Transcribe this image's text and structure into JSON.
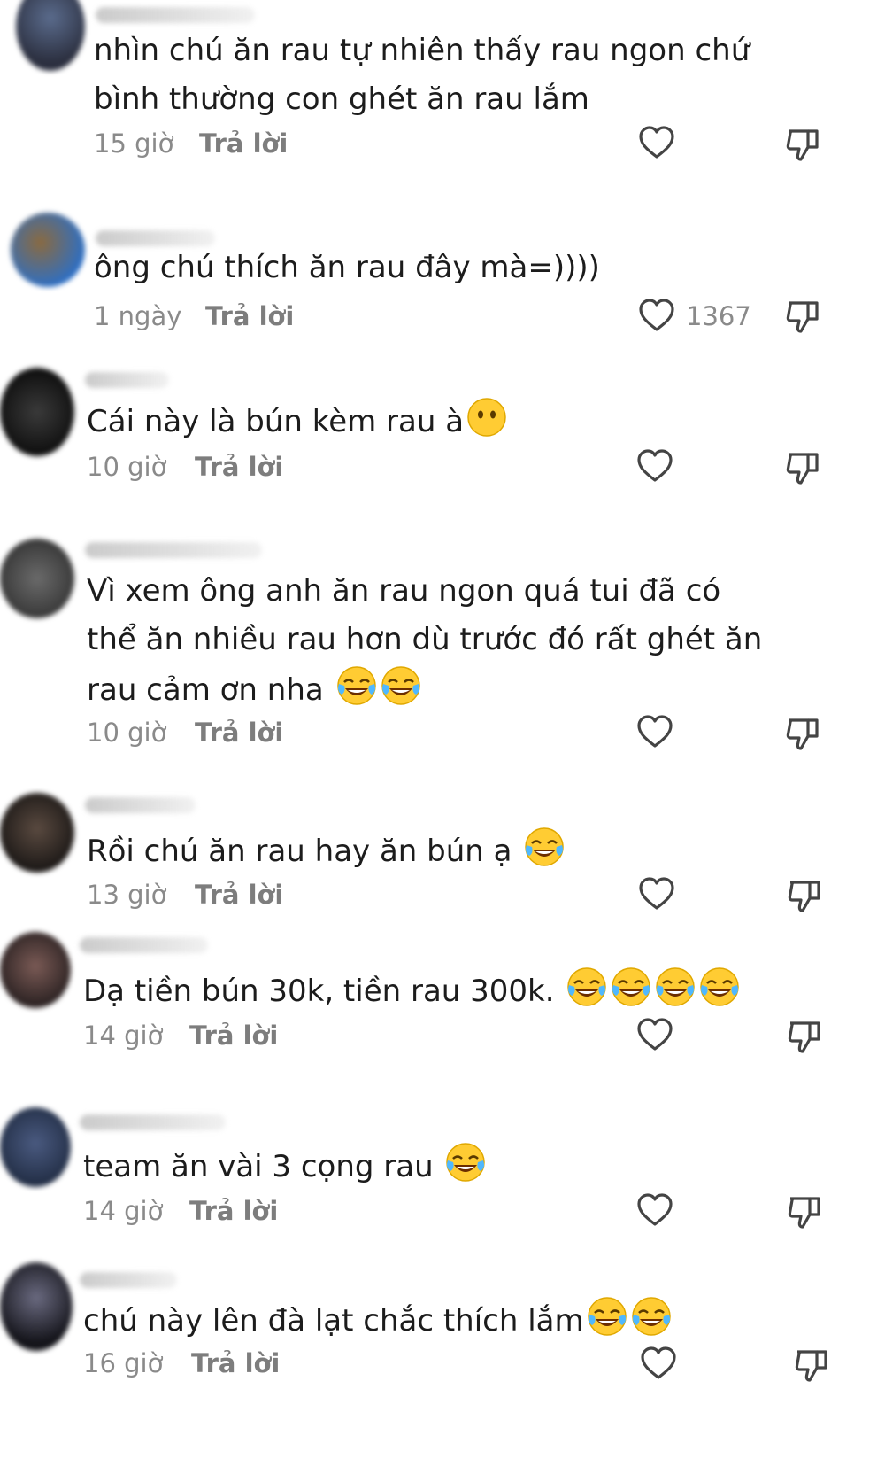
{
  "comments": [
    {
      "text": "nhìn chú ăn rau tự nhiên thấy rau ngon chứ\nbình thường con ghét ăn rau lắm",
      "time": "15 giờ",
      "reply": "Trả lời"
    },
    {
      "text": "ông chú thích ăn rau đây mà=))))",
      "time": "1 ngày",
      "reply": "Trả lời",
      "likes": "1367"
    },
    {
      "text": "Cái này là bún kèm rau à",
      "time": "10 giờ",
      "reply": "Trả lời",
      "emoji": "neutral-face-emoji"
    },
    {
      "text": "Vì xem ông anh ăn rau ngon quá tui đã có\nthể ăn nhiều rau hơn dù trước đó rất ghét ăn\nrau cảm ơn nha ",
      "time": "10 giờ",
      "reply": "Trả lời",
      "emoji": "tears-of-joy-emoji x2"
    },
    {
      "text": "Rồi chú ăn rau hay ăn bún ạ ",
      "time": "13 giờ",
      "reply": "Trả lời",
      "emoji": "tears-of-joy-emoji"
    },
    {
      "text": "Dạ tiền bún 30k, tiền rau 300k. ",
      "time": "14 giờ",
      "reply": "Trả lời",
      "emoji": "tears-of-joy-emoji x4"
    },
    {
      "text": "team ăn vài 3 cọng rau ",
      "time": "14 giờ",
      "reply": "Trả lời",
      "emoji": "tears-of-joy-emoji"
    },
    {
      "text": "chú này lên đà lạt chắc thích lắm",
      "time": "16 giờ",
      "reply": "Trả lời",
      "emoji": "tears-of-joy-emoji x2"
    }
  ]
}
